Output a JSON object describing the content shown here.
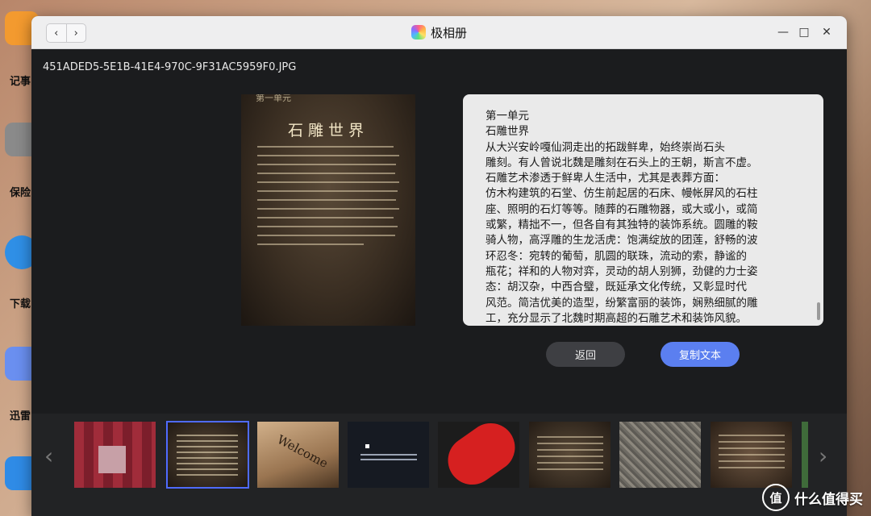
{
  "desktop": {
    "labels": [
      "记事",
      "保险",
      "下载",
      "迅雷"
    ],
    "accent_colors": [
      "#f39a2f",
      "#9a9a9a",
      "#2f8fe6",
      "#6a8ff0",
      "#2f8be6"
    ]
  },
  "window": {
    "title": "极相册",
    "nav_back": "‹",
    "nav_forward": "›",
    "minimize": "—",
    "maximize": "□",
    "close": "✕"
  },
  "viewer": {
    "filename": "451ADED5-5E1B-41E4-970C-9F31AC5959F0.JPG",
    "photo_header": "第一单元",
    "photo_title": "石雕世界",
    "ocr_text": "第一单元\n石雕世界\n从大兴安岭嘎仙洞走出的拓跋鲜卑，始终崇尚石头\n雕刻。有人曾说北魏是雕刻在石头上的王朝，斯言不虚。\n石雕艺术渗透于鲜卑人生活中，尤其是表葬方面：\n仿木构建筑的石堂、仿生前起居的石床、幔帐屏风的石柱\n座、照明的石灯等等。随葬的石雕物器，或大或小，或简\n或繁，精拙不一，但各自有其独特的装饰系统。圆雕的鞍\n骑人物，高浮雕的生龙活虎：饱满绽放的团莲，舒畅的波\n环忍冬：宛转的葡萄，肌圆的联珠，流动的索，静谧的\n瓶花；祥和的人物对弈，灵动的胡人别狮，劲健的力士姿\n态：胡汉杂，中西合璧，既延承文化传统，又彰显时代\n风范。简洁优美的造型，纷繁富丽的装饰，娴熟细腻的雕\n工，充分显示了北魏时期高超的石雕艺术和装饰风貌。",
    "back_button": "返回",
    "copy_button": "复制文本",
    "colors": {
      "copy_button": "#5b7ff0",
      "back_button": "#3e3f43",
      "selection": "#4f6bff"
    }
  },
  "filmstrip": {
    "prev": "‹",
    "next": "›",
    "thumbnails": [
      {
        "kind": "pixelated-photo"
      },
      {
        "kind": "stone-carving-plaque",
        "selected": true
      },
      {
        "kind": "welcome-sign",
        "text": "Welcome"
      },
      {
        "kind": "dark-text-panel"
      },
      {
        "kind": "red-lantern"
      },
      {
        "kind": "text-plaque"
      },
      {
        "kind": "stone-texture"
      },
      {
        "kind": "text-plaque"
      },
      {
        "kind": "partial-green"
      }
    ]
  },
  "watermark": {
    "icon": "值",
    "text": "什么值得买"
  }
}
